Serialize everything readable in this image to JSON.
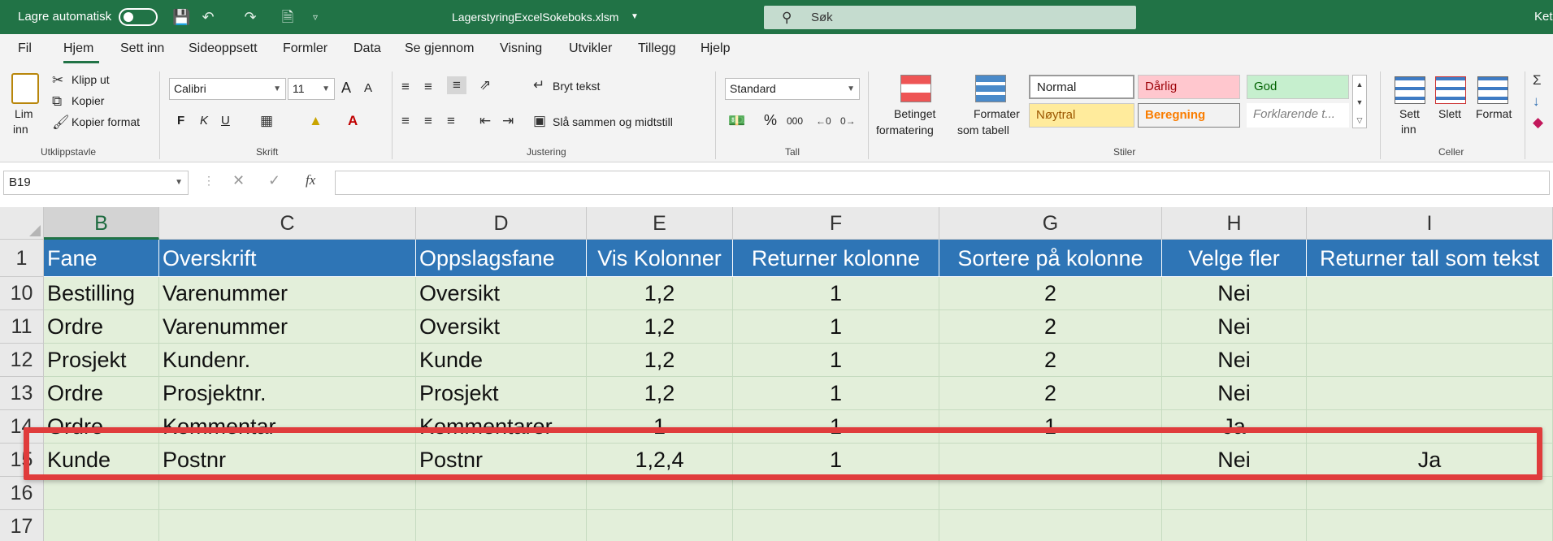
{
  "titlebar": {
    "autosave": "Lagre automatisk",
    "filename": "LagerstyringExcelSokeboks.xlsm",
    "search": "Søk",
    "user": "Keti"
  },
  "menu": [
    "Fil",
    "Hjem",
    "Sett inn",
    "Sideoppsett",
    "Formler",
    "Data",
    "Se gjennom",
    "Visning",
    "Utvikler",
    "Tillegg",
    "Hjelp"
  ],
  "ribbon": {
    "clipboard": {
      "paste": "Lim",
      "paste2": "inn",
      "cut": "Klipp ut",
      "copy": "Kopier",
      "format_painter": "Kopier format",
      "group": "Utklippstavle"
    },
    "font": {
      "name": "Calibri",
      "size": "11",
      "bold": "F",
      "italic": "K",
      "underline": "U",
      "grow": "A",
      "shrink": "A",
      "group": "Skrift"
    },
    "alignment": {
      "wrap": "Bryt tekst",
      "merge": "Slå sammen og midtstill",
      "group": "Justering"
    },
    "number": {
      "format": "Standard",
      "percent": "%",
      "thousands": "000",
      "group": "Tall"
    },
    "styles": {
      "conditional": "Betinget",
      "conditional2": "formatering",
      "table": "Formater",
      "table2": "som tabell",
      "normal": "Normal",
      "bad": "Dårlig",
      "good": "God",
      "neutral": "Nøytral",
      "calc": "Beregning",
      "explanatory": "Forklarende t...",
      "group": "Stiler"
    },
    "cells": {
      "insert": "Sett",
      "insert2": "inn",
      "delete": "Slett",
      "format": "Format",
      "group": "Celler"
    }
  },
  "formula_bar": {
    "name_box": "B19",
    "cancel": "✕",
    "enter": "✓",
    "fx": "fx"
  },
  "columns": [
    "B",
    "C",
    "D",
    "E",
    "F",
    "G",
    "H",
    "I"
  ],
  "rows": [
    {
      "num": "1",
      "cells": [
        "Fane",
        "Overskrift",
        "Oppslagsfane",
        "Vis Kolonner",
        "Returner kolonne",
        "Sortere på kolonne",
        "Velge fler",
        "Returner tall som tekst"
      ]
    },
    {
      "num": "10",
      "cells": [
        "Bestilling",
        "Varenummer",
        "Oversikt",
        "1,2",
        "1",
        "2",
        "Nei",
        ""
      ]
    },
    {
      "num": "11",
      "cells": [
        "Ordre",
        "Varenummer",
        "Oversikt",
        "1,2",
        "1",
        "2",
        "Nei",
        ""
      ]
    },
    {
      "num": "12",
      "cells": [
        "Prosjekt",
        "Kundenr.",
        "Kunde",
        "1,2",
        "1",
        "2",
        "Nei",
        ""
      ]
    },
    {
      "num": "13",
      "cells": [
        "Ordre",
        "Prosjektnr.",
        "Prosjekt",
        "1,2",
        "1",
        "2",
        "Nei",
        ""
      ]
    },
    {
      "num": "14",
      "cells": [
        "Ordre",
        "Kommentar",
        "Kommentarer",
        "1",
        "1",
        "1",
        "Ja",
        ""
      ]
    },
    {
      "num": "15",
      "cells": [
        "Kunde",
        "Postnr",
        "Postnr",
        "1,2,4",
        "1",
        "",
        "Nei",
        "Ja"
      ]
    },
    {
      "num": "16",
      "cells": [
        "",
        "",
        "",
        "",
        "",
        "",
        "",
        ""
      ]
    },
    {
      "num": "17",
      "cells": [
        "",
        "",
        "",
        "",
        "",
        "",
        "",
        ""
      ]
    }
  ]
}
